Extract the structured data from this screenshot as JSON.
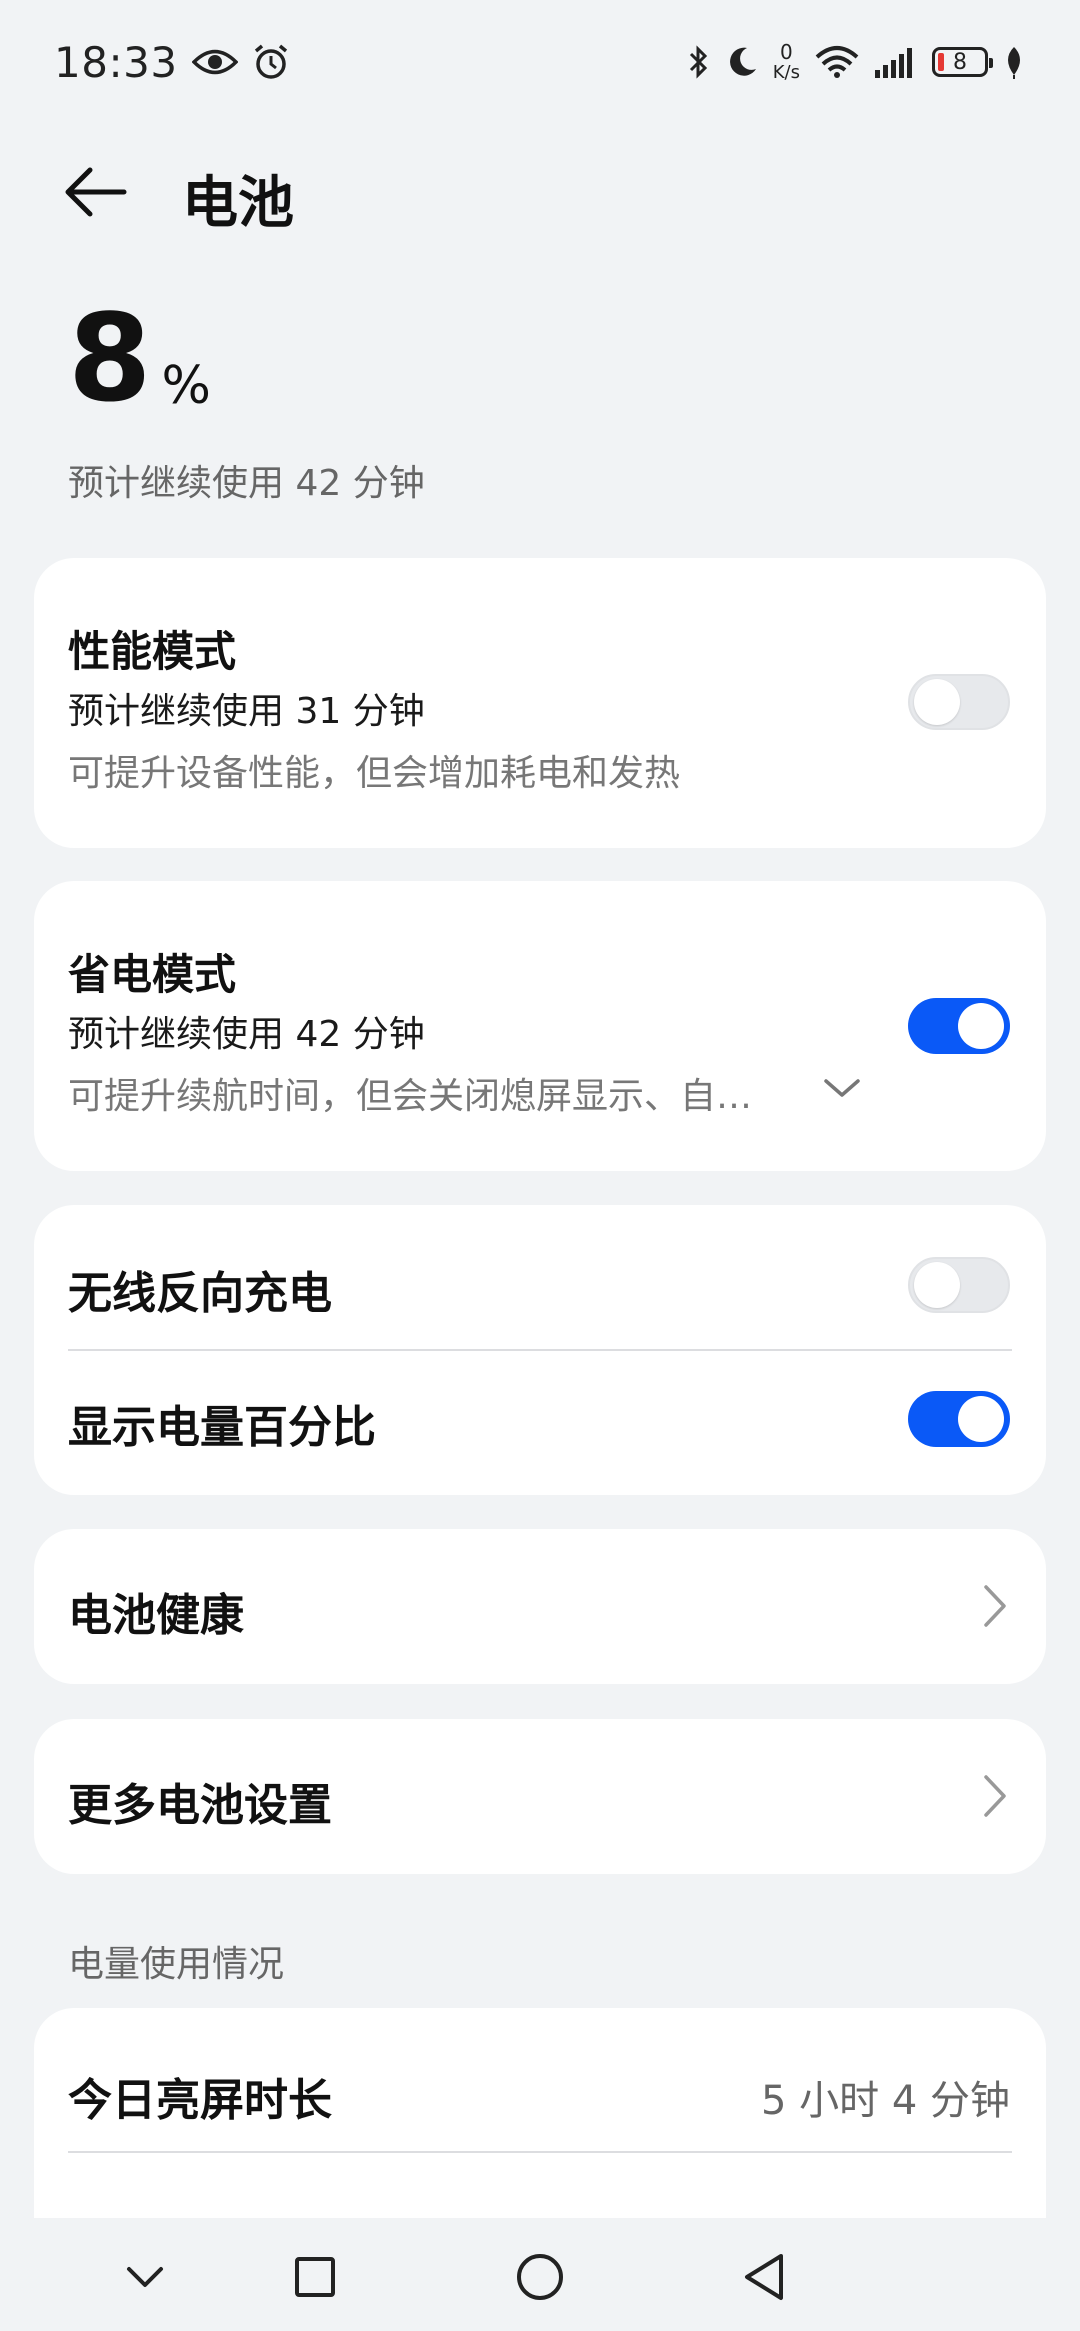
{
  "status_bar": {
    "time": "18:33",
    "net_speed_value": "0",
    "net_speed_unit": "K/s",
    "battery_level": "8",
    "icons_left": [
      "eye-icon",
      "alarm-icon"
    ],
    "icons_right": [
      "bluetooth-icon",
      "moon-icon",
      "wifi-icon",
      "signal-icon",
      "battery-icon",
      "leaf-icon"
    ]
  },
  "header": {
    "title": "电池"
  },
  "summary": {
    "percent": "8",
    "percent_sign": "%",
    "estimate": "预计继续使用 42 分钟"
  },
  "performance_mode": {
    "title": "性能模式",
    "estimate": "预计继续使用 31 分钟",
    "description": "可提升设备性能，但会增加耗电和发热",
    "enabled": false
  },
  "power_saving_mode": {
    "title": "省电模式",
    "estimate": "预计继续使用 42 分钟",
    "description": "可提升续航时间，但会关闭熄屏显示、自…",
    "enabled": true
  },
  "toggles_card": {
    "wireless_reverse_charging": {
      "title": "无线反向充电",
      "enabled": false
    },
    "show_battery_percentage": {
      "title": "显示电量百分比",
      "enabled": true
    }
  },
  "battery_health": {
    "title": "电池健康"
  },
  "more_settings": {
    "title": "更多电池设置"
  },
  "usage": {
    "section_label": "电量使用情况",
    "screen_on_today_label": "今日亮屏时长",
    "screen_on_today_value": "5 小时 4 分钟"
  },
  "colors": {
    "accent": "#0a59f7",
    "background": "#f1f3f5",
    "card": "#ffffff",
    "battery_low": "#e53935"
  }
}
